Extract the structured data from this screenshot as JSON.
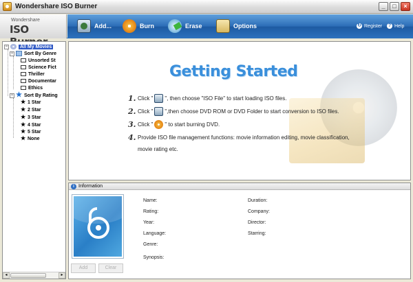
{
  "window": {
    "title": "Wondershare ISO Burner",
    "controls": {
      "minimize": "_",
      "maximize": "□",
      "close": "×"
    }
  },
  "logo": {
    "small": "Wondershare",
    "big": "ISO Burner"
  },
  "toolbar": {
    "add": "Add...",
    "burn": "Burn",
    "erase": "Erase",
    "options": "Options",
    "register": "Register",
    "help": "Help"
  },
  "tree": {
    "root": "All My Movies",
    "genre_group": "Sort By Genre",
    "genres": [
      "Unsorted St",
      "Science Fict",
      "Thriller",
      "Documentar",
      "Ethics"
    ],
    "rating_group": "Sort By Rating",
    "ratings": [
      "1 Star",
      "2 Star",
      "3 Star",
      "4 Star",
      "5 Star",
      "None"
    ]
  },
  "getting_started": {
    "title": "Getting Started",
    "steps": [
      {
        "num": "1.",
        "pre": "Click \"",
        "post": "\", then choose \"ISO File\" to start loading ISO files."
      },
      {
        "num": "2.",
        "pre": "Click \"",
        "post": "\",then choose DVD ROM or DVD Folder to start conversion to ISO files."
      },
      {
        "num": "3.",
        "pre": "Click \"",
        "post": "\" to start burning DVD."
      },
      {
        "num": "4.",
        "pre": "Provide ISO file management functions: movie information editing, movie classification,",
        "post": ""
      }
    ],
    "step4_line2": "movie rating etc."
  },
  "info": {
    "header": "Information",
    "add_button": "Add",
    "clear_button": "Clear",
    "labels": {
      "name": "Name:",
      "rating": "Rating:",
      "year": "Year:",
      "language": "Language:",
      "genre": "Genre:",
      "synopsis": "Synopsis:",
      "duration": "Duration:",
      "company": "Company:",
      "director": "Director:",
      "starring": "Starring:"
    }
  },
  "colors": {
    "accent": "#2b6cb6",
    "title_blue": "#3a8fdb",
    "selection": "#2e58c5"
  }
}
